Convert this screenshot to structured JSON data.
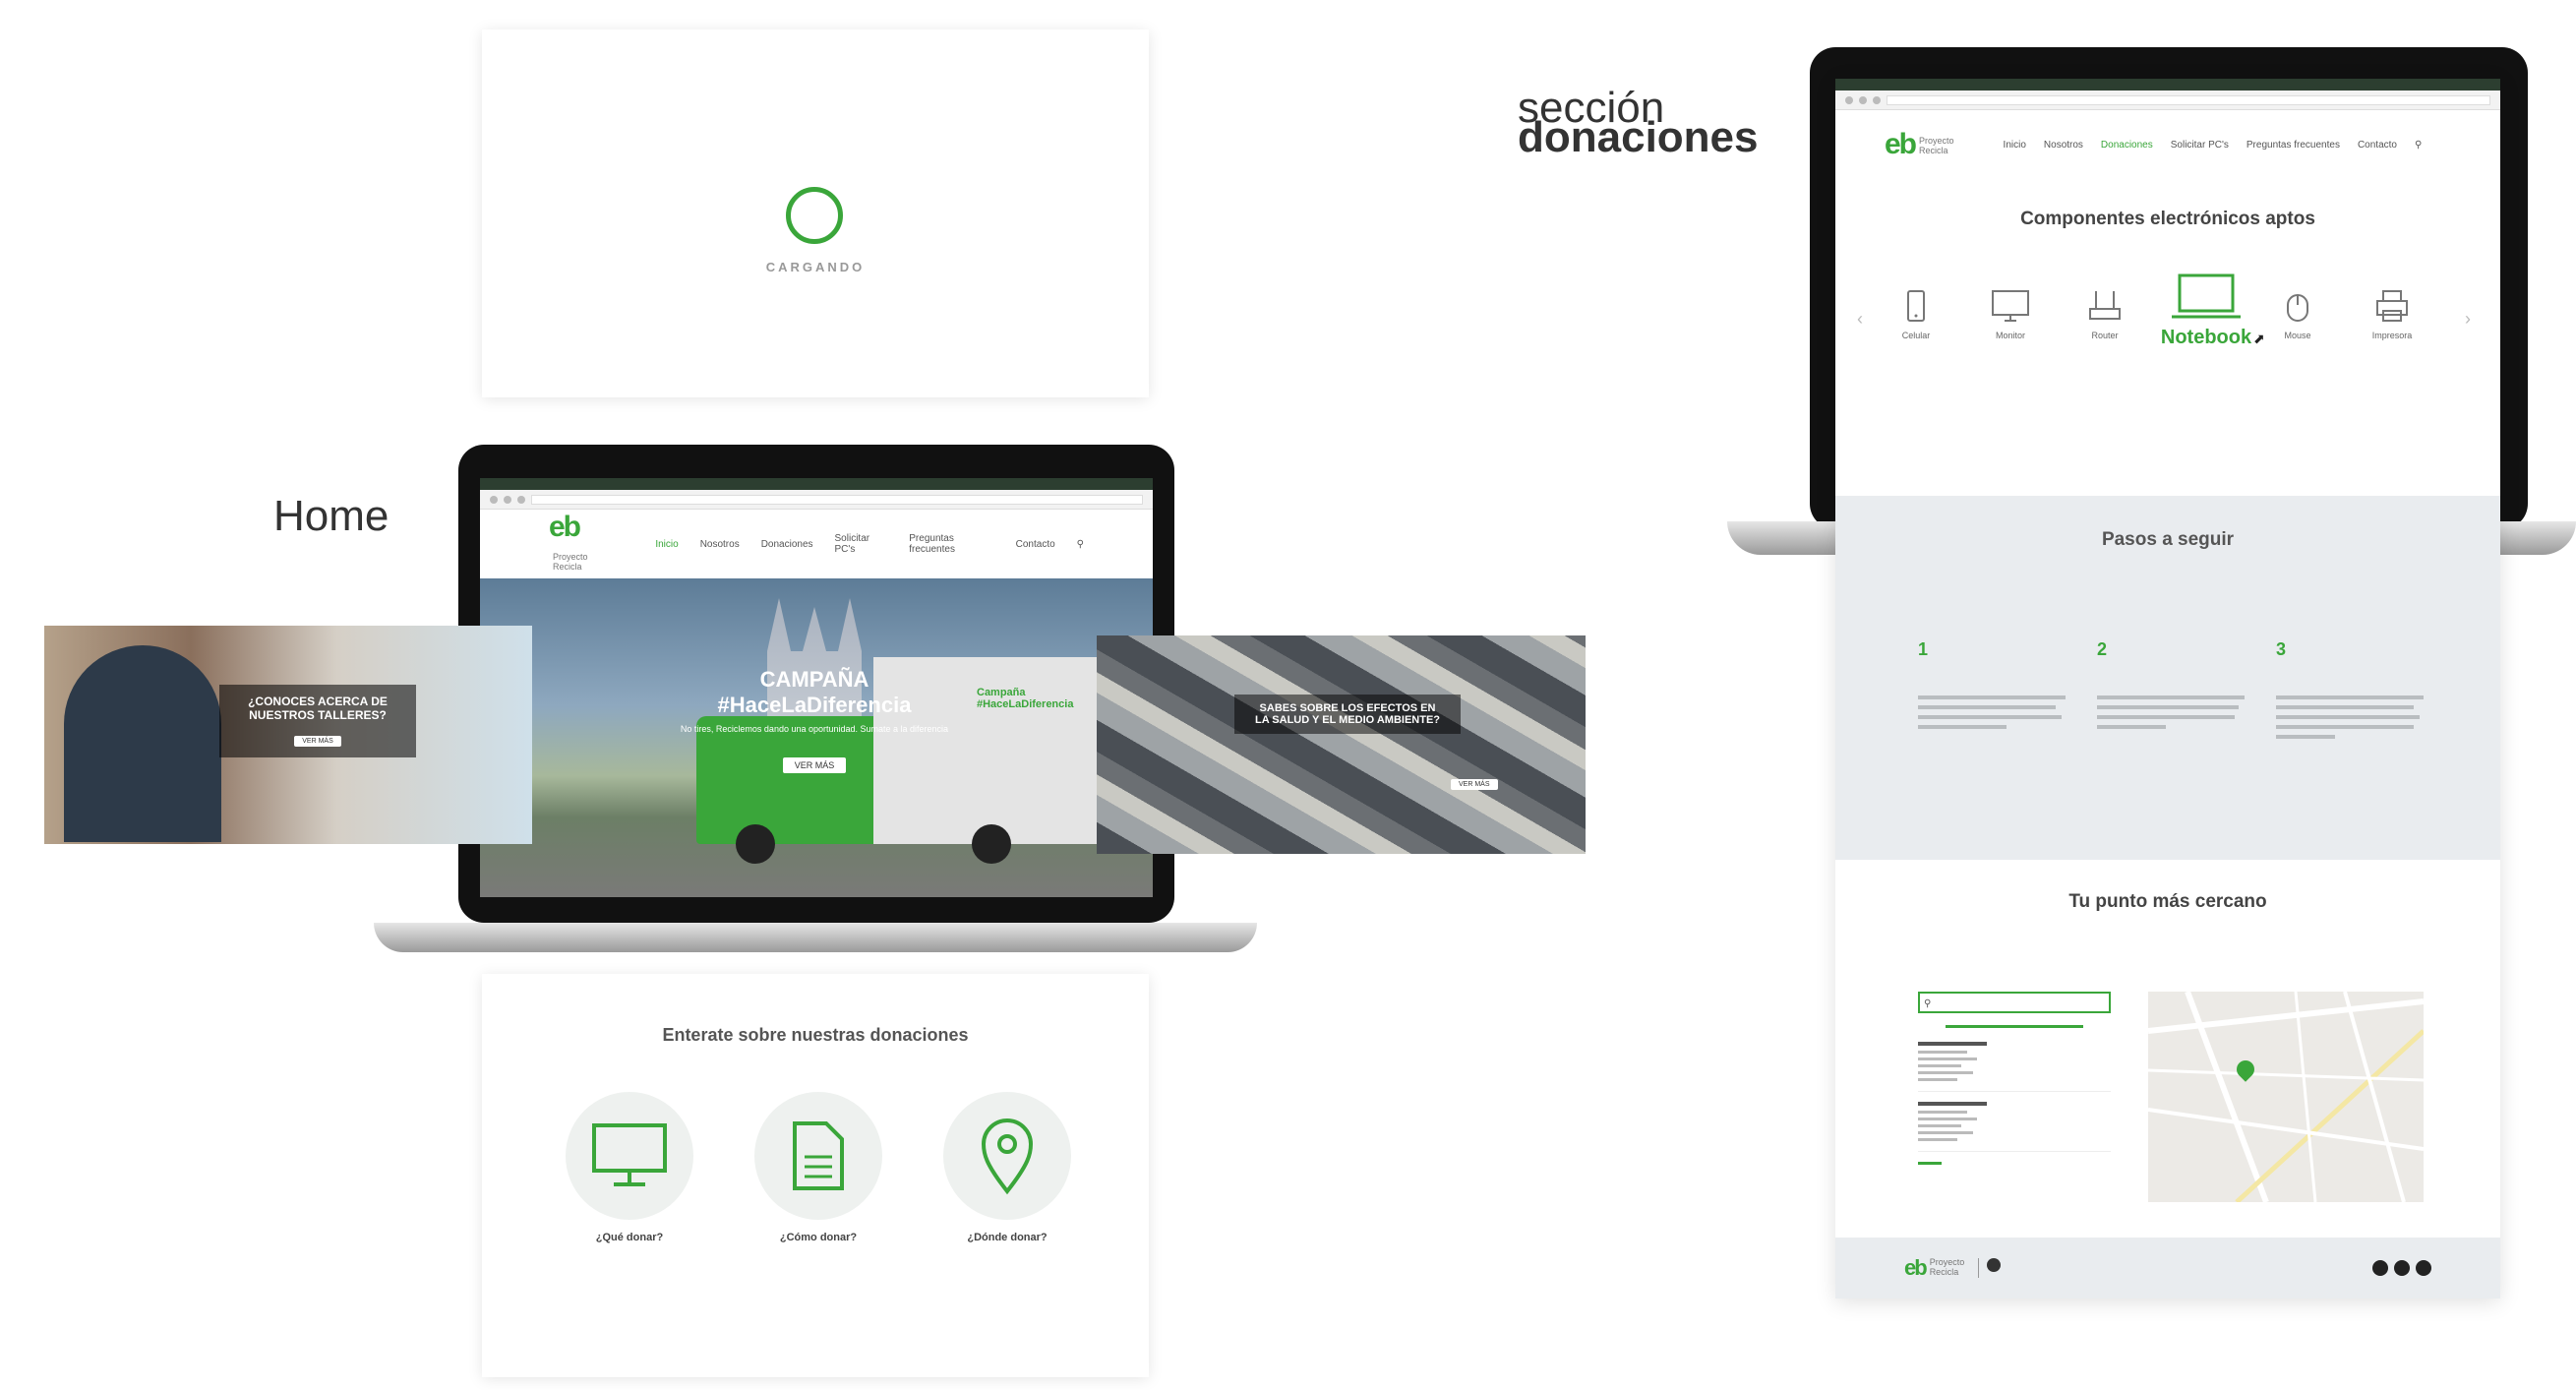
{
  "loader": {
    "label": "CARGANDO"
  },
  "labels": {
    "home": "Home",
    "section_top": "sección",
    "section_bottom": "donaciones"
  },
  "colors": {
    "accent": "#3aa63a",
    "dark_green": "#2c3e30",
    "gray_section": "#e9ecef"
  },
  "home_screen": {
    "nav": [
      "Inicio",
      "Nosotros",
      "Donaciones",
      "Solicitar PC's",
      "Preguntas frecuentes",
      "Contacto"
    ],
    "hero": {
      "title": "CAMPAÑA",
      "hashtag": "#HaceLaDiferencia",
      "text": "No tires, Reciclemos dando una oportunidad. Sumate a la diferencia",
      "button": "VER MÁS"
    },
    "truck_sign": {
      "line1": "Campaña",
      "line2": "#HaceLaDiferencia"
    }
  },
  "side_left": {
    "title_line1": "¿CONOCES ACERCA DE",
    "title_line2": "NUESTROS TALLERES?",
    "button": "VER MÁS"
  },
  "side_right": {
    "title_line1": "SABES SOBRE LOS EFECTOS EN",
    "title_line2": "LA SALUD Y EL MEDIO AMBIENTE?",
    "button": "VER MÁS"
  },
  "donations_card": {
    "title": "Enterate sobre nuestras donaciones",
    "items": [
      {
        "icon": "monitor-icon",
        "label": "¿Qué donar?"
      },
      {
        "icon": "document-icon",
        "label": "¿Cómo donar?"
      },
      {
        "icon": "location-pin-icon",
        "label": "¿Dónde donar?"
      }
    ]
  },
  "donaciones_page": {
    "nav": [
      "Inicio",
      "Nosotros",
      "Donaciones",
      "Solicitar PC's",
      "Preguntas frecuentes",
      "Contacto"
    ],
    "components_title": "Componentes electrónicos aptos",
    "components": [
      {
        "icon": "phone-icon",
        "label": "Celular",
        "active": false
      },
      {
        "icon": "monitor-icon",
        "label": "Monitor",
        "active": false
      },
      {
        "icon": "router-icon",
        "label": "Router",
        "active": false
      },
      {
        "icon": "notebook-icon",
        "label": "Notebook",
        "active": true
      },
      {
        "icon": "mouse-icon",
        "label": "Mouse",
        "active": false
      },
      {
        "icon": "printer-icon",
        "label": "Impresora",
        "active": false
      }
    ],
    "steps_title": "Pasos a seguir",
    "steps": [
      {
        "num": "1"
      },
      {
        "num": "2"
      },
      {
        "num": "3"
      }
    ],
    "nearest_title": "Tu punto más cercano"
  }
}
